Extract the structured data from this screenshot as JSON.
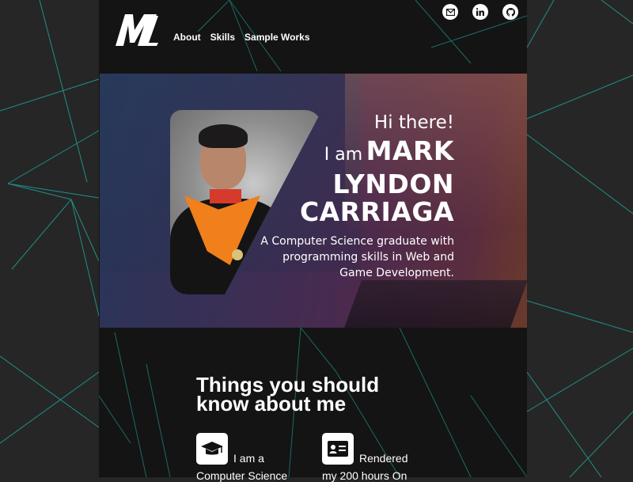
{
  "nav": {
    "logo_text": "ML",
    "links": [
      "About",
      "Skills",
      "Sample Works"
    ],
    "social": [
      "mail-icon",
      "linkedin-icon",
      "github-icon"
    ]
  },
  "hero": {
    "greeting": "Hi there!",
    "iam": "I am",
    "name_line1": "MARK",
    "name_line2": "LYNDON",
    "name_line3": "CARRIAGA",
    "tagline_line1": "A Computer Science graduate with",
    "tagline_line2": "programming skills in Web and",
    "tagline_line3": "Game Development."
  },
  "about": {
    "title_line1": "Things you should",
    "title_line2": "know about me",
    "cards": [
      {
        "icon": "graduation-cap-icon",
        "text_line1": "I am a",
        "text_line2": "Computer Science"
      },
      {
        "icon": "id-card-icon",
        "text_line1": "Rendered",
        "text_line2": "my 200 hours On"
      }
    ]
  }
}
